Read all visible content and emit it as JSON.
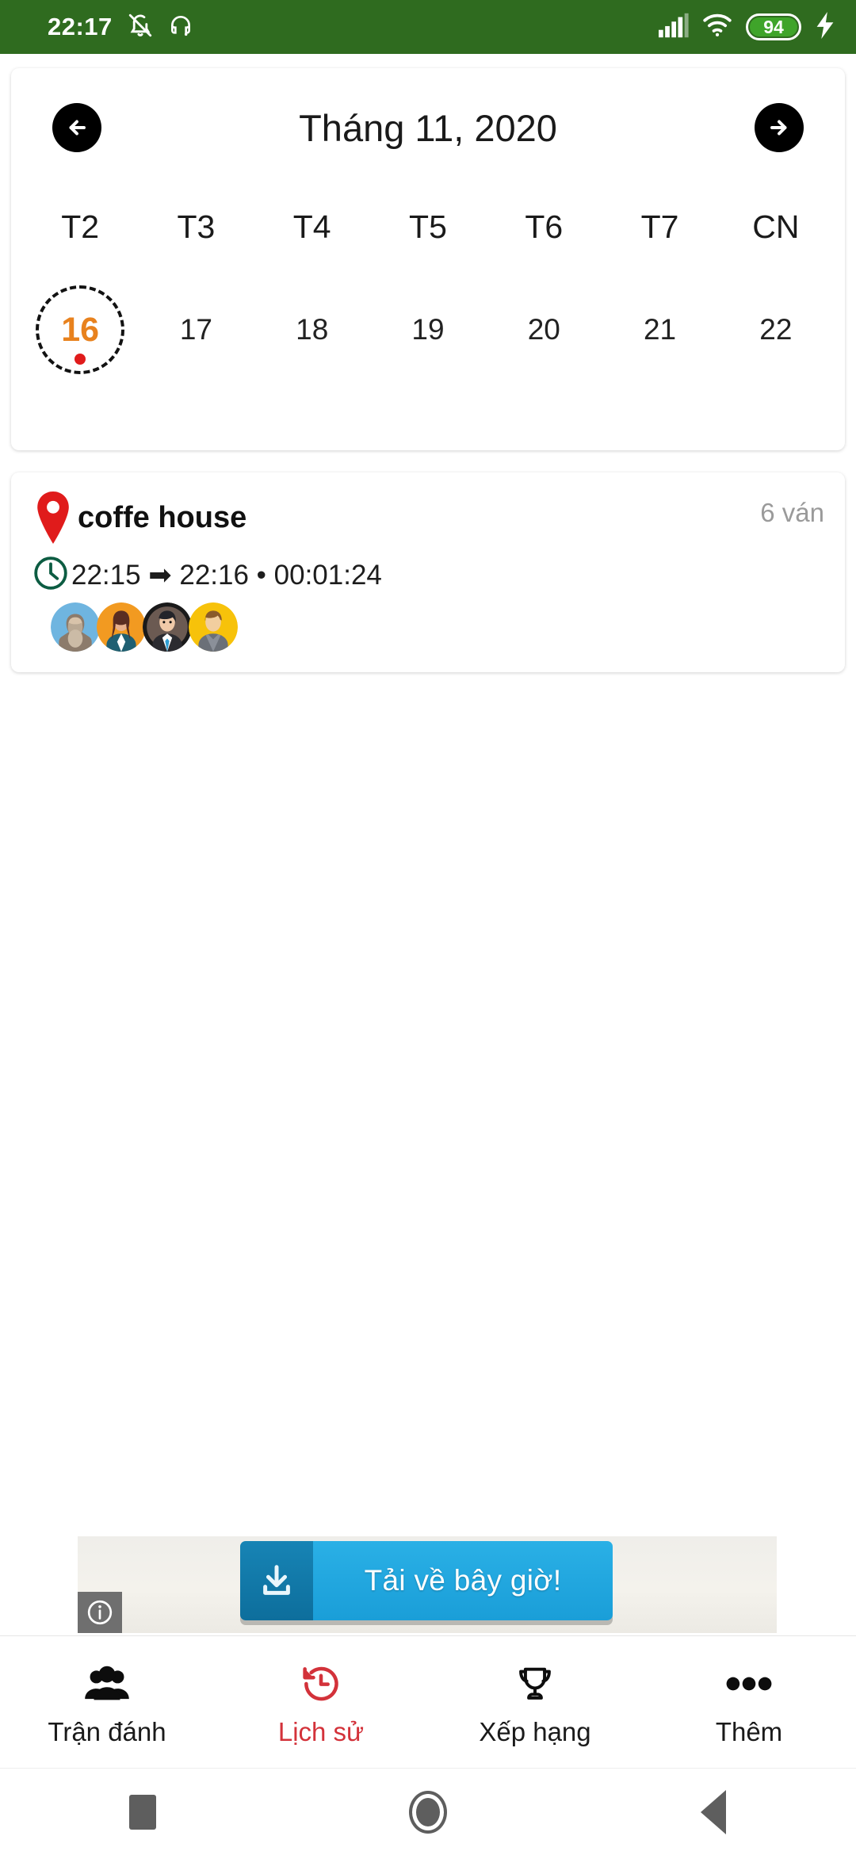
{
  "status_bar": {
    "time": "22:17",
    "battery_level": "94",
    "icons": [
      "bell-muted-icon",
      "headset-icon",
      "signal-icon",
      "wifi-icon",
      "battery-icon",
      "charging-bolt-icon"
    ],
    "background_color": "#2f6b1f"
  },
  "calendar": {
    "title": "Tháng 11, 2020",
    "prev_label": "prev-month",
    "next_label": "next-month",
    "weekdays": [
      "T2",
      "T3",
      "T4",
      "T5",
      "T6",
      "T7",
      "CN"
    ],
    "dates": [
      {
        "day": "16",
        "selected": true,
        "has_event": true
      },
      {
        "day": "17",
        "selected": false,
        "has_event": false
      },
      {
        "day": "18",
        "selected": false,
        "has_event": false
      },
      {
        "day": "19",
        "selected": false,
        "has_event": false
      },
      {
        "day": "20",
        "selected": false,
        "has_event": false
      },
      {
        "day": "21",
        "selected": false,
        "has_event": false
      },
      {
        "day": "22",
        "selected": false,
        "has_event": false
      }
    ],
    "selected_color": "#e8821e",
    "event_dot_color": "#e01b1b"
  },
  "history": {
    "place": "coffe house",
    "rounds": "6 ván",
    "time_range": "22:15 ➡ 22:16 • 00:01:24",
    "start_time": "22:15",
    "end_time": "22:16",
    "duration": "00:01:24",
    "players": [
      {
        "avatar_bg": "#6fb5e0"
      },
      {
        "avatar_bg": "#f29a21"
      },
      {
        "avatar_bg": "#2b2b2b"
      },
      {
        "avatar_bg": "#f7c20a"
      }
    ],
    "pin_color": "#e01b1b",
    "clock_color": "#0c5c42"
  },
  "ad": {
    "cta_label": "Tải về bây giờ!",
    "download_icon": "download-icon",
    "info_icon": "info-icon",
    "cta_color": "#1a9ed8"
  },
  "tabs": [
    {
      "label": "Trận đánh",
      "icon": "people-icon",
      "active": false
    },
    {
      "label": "Lịch sử",
      "icon": "history-icon",
      "active": true
    },
    {
      "label": "Xếp hạng",
      "icon": "trophy-icon",
      "active": false
    },
    {
      "label": "Thêm",
      "icon": "ellipsis-icon",
      "active": false
    }
  ],
  "tab_active_color": "#d3323a",
  "android_nav": {
    "recents": "recents-button",
    "home": "home-button",
    "back": "back-button"
  }
}
